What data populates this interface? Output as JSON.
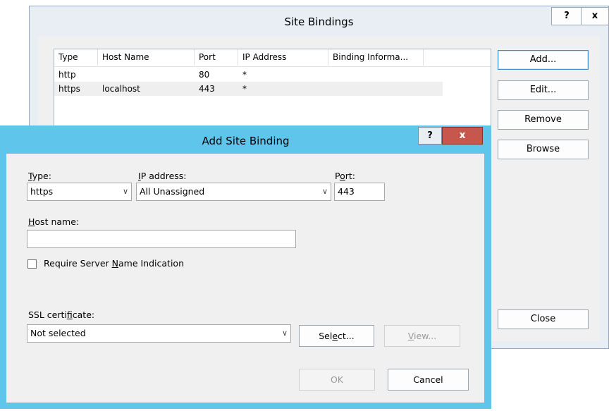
{
  "site_bindings": {
    "title": "Site Bindings",
    "help_button": "?",
    "close_button": "x",
    "columns": [
      "Type",
      "Host Name",
      "Port",
      "IP Address",
      "Binding Informa..."
    ],
    "rows": [
      {
        "type": "http",
        "host": "",
        "port": "80",
        "ip": "*",
        "info": ""
      },
      {
        "type": "https",
        "host": "localhost",
        "port": "443",
        "ip": "*",
        "info": ""
      }
    ],
    "buttons": {
      "add": "Add...",
      "edit": "Edit...",
      "remove": "Remove",
      "browse": "Browse",
      "close": "Close"
    }
  },
  "add_site_binding": {
    "title": "Add Site Binding",
    "help_button": "?",
    "close_button": "x",
    "type": {
      "label_accel": "T",
      "label_rest": "ype:",
      "value": "https"
    },
    "ip_address": {
      "label_accel": "I",
      "label_rest": "P address:",
      "value": "All Unassigned"
    },
    "port": {
      "label_pre": "P",
      "label_accel": "o",
      "label_rest": "rt:",
      "value": "443"
    },
    "host_name": {
      "label_accel": "H",
      "label_rest": "ost name:",
      "value": ""
    },
    "require_sni": {
      "label_pre": "Require Server ",
      "label_accel": "N",
      "label_rest": "ame Indication",
      "checked": false
    },
    "ssl_certificate": {
      "label_pre": "SSL certi",
      "label_accel": "f",
      "label_rest": "icate:",
      "value": "Not selected"
    },
    "select_button": {
      "pre": "Sel",
      "accel": "e",
      "rest": "ct..."
    },
    "view_button": {
      "accel": "V",
      "rest": "iew..."
    },
    "ok_button": "OK",
    "cancel_button": "Cancel"
  },
  "colors": {
    "front_frame": "#5fc5ea",
    "close_red": "#c7574c",
    "back_frame": "#e8eef4"
  }
}
